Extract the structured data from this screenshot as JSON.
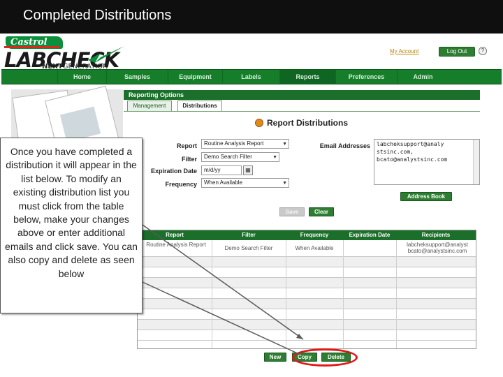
{
  "slide": {
    "title": "Completed Distributions"
  },
  "header": {
    "castrol": "Castrol",
    "labcheck": "LABCHECK",
    "next": "NEXT",
    "generation": "GENERATION",
    "my_account": "My Account",
    "logout": "Log Out",
    "help": "?"
  },
  "nav": [
    "Home",
    "Samples",
    "Equipment",
    "Labels",
    "Reports",
    "Preferences",
    "Admin"
  ],
  "reporting": {
    "section_title": "Reporting Options",
    "tabs": [
      "Management",
      "Distributions"
    ],
    "page_title": "Report Distributions"
  },
  "form": {
    "report_label": "Report",
    "report_value": "Routine Analysis Report",
    "filter_label": "Filter",
    "filter_value": "Demo Search Filter",
    "expiration_label": "Expiration Date",
    "expiration_placeholder": "m/d/yy",
    "frequency_label": "Frequency",
    "frequency_value": "When Available",
    "email_label": "Email Addresses",
    "emails": [
      "labcheksupport@analy",
      "stsinc.com,",
      "bcato@analystsinc.com"
    ],
    "address_book": "Address Book",
    "save": "Save",
    "clear": "Clear"
  },
  "table": {
    "headers": [
      "Report",
      "Filter",
      "Frequency",
      "Expiration Date",
      "Recipients"
    ],
    "row": {
      "report": "Routine Analysis Report",
      "filter": "Demo Search Filter",
      "frequency": "When Available",
      "expiration": "",
      "recipients": [
        "labcheksupport@analyst",
        "bcato@analystsinc.com"
      ]
    }
  },
  "actions": {
    "new": "New",
    "copy": "Copy",
    "delete": "Delete"
  },
  "callout": "Once you have completed a distribution it will appear in the list below. To modify an existing distribution list you must click from the table below, make your changes above or enter additional emails and click save. You can also copy and delete as seen below",
  "colors": {
    "brand_green": "#167d2b",
    "highlight_red": "#e01818",
    "title_bar": "#0f0f0f"
  }
}
